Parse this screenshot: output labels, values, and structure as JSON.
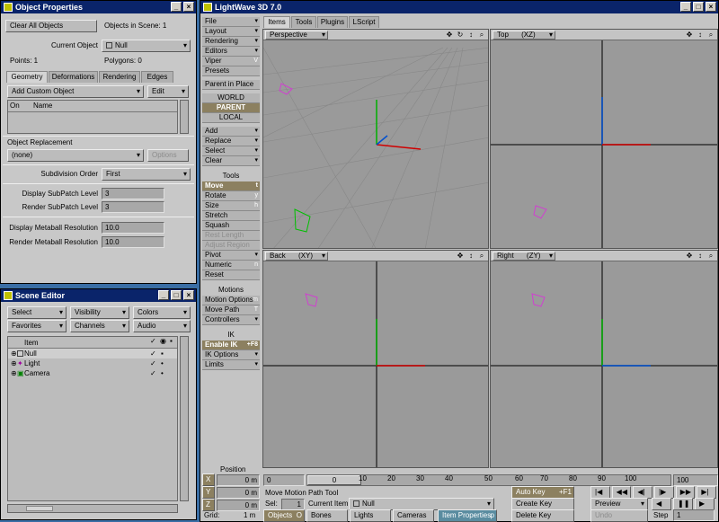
{
  "object_properties": {
    "title": "Object Properties",
    "clear_all": "Clear All Objects",
    "objects_in_scene": "Objects in Scene: 1",
    "current_object_label": "Current Object",
    "current_object_value": "Null",
    "points": "Points: 1",
    "polygons": "Polygons: 0",
    "tabs": [
      "Geometry",
      "Deformations",
      "Rendering",
      "Edges"
    ],
    "add_custom_object": "Add Custom Object",
    "edit": "Edit",
    "col_on": "On",
    "col_name": "Name",
    "object_replacement": "Object Replacement",
    "replacement_value": "(none)",
    "options": "Options",
    "subdivision_order_label": "Subdivision Order",
    "subdivision_order_value": "First",
    "display_subpatch_label": "Display SubPatch Level",
    "display_subpatch_value": "3",
    "render_subpatch_label": "Render SubPatch Level",
    "render_subpatch_value": "3",
    "display_metaball_label": "Display Metaball Resolution",
    "display_metaball_value": "10.0",
    "render_metaball_label": "Render Metaball Resolution",
    "render_metaball_value": "10.0"
  },
  "scene_editor": {
    "title": "Scene Editor",
    "select": "Select",
    "visibility": "Visibility",
    "colors": "Colors",
    "favorites": "Favorites",
    "channels": "Channels",
    "audio": "Audio",
    "col_item": "Item",
    "items": [
      "Null",
      "Light",
      "Camera"
    ]
  },
  "lightwave": {
    "title": "LightWave 3D 7.0",
    "top_tabs": [
      "Items",
      "Tools",
      "Plugins",
      "LScript"
    ],
    "menu": {
      "file": "File",
      "layout": "Layout",
      "rendering": "Rendering",
      "editors": "Editors",
      "viper": "Viper",
      "viper_key": "V",
      "presets": "Presets",
      "parent_in_place": "Parent in Place",
      "world": "WORLD",
      "parent": "PARENT",
      "local": "LOCAL",
      "add": "Add",
      "replace": "Replace",
      "select": "Select",
      "clear": "Clear",
      "tools_header": "Tools",
      "move": "Move",
      "move_key": "t",
      "rotate": "Rotate",
      "rotate_key": "y",
      "size": "Size",
      "size_key": "h",
      "stretch": "Stretch",
      "squash": "Squash",
      "rest_length": "Rest Length",
      "adjust_region": "Adjust Region",
      "pivot": "Pivot",
      "numeric": "Numeric",
      "numeric_key": "n",
      "reset": "Reset",
      "motions_header": "Motions",
      "motion_options": "Motion Options",
      "motion_options_key": "m",
      "move_path": "Move Path",
      "move_path_key": "T",
      "controllers": "Controllers",
      "ik_header": "IK",
      "enable_ik": "Enable IK",
      "enable_ik_key": "+F8",
      "ik_options": "IK Options",
      "limits": "Limits"
    },
    "viewports": {
      "perspective": "Perspective",
      "top": "Top",
      "top_axes": "(XZ)",
      "back": "Back",
      "back_axes": "(XY)",
      "right": "Right",
      "right_axes": "(ZY)"
    },
    "bottom": {
      "position": "Position",
      "x": "X",
      "y": "Y",
      "z": "Z",
      "x_val": "0 m",
      "y_val": "0 m",
      "z_val": "0 m",
      "grid_label": "Grid:",
      "grid_val": "1 m",
      "timeline_start": "0",
      "timeline_current": "0",
      "timeline_end": "100",
      "ticks": [
        "10",
        "20",
        "30",
        "40",
        "50",
        "60",
        "70",
        "80",
        "90",
        "100"
      ],
      "status": "Move Motion Path Tool",
      "sel_label": "Sel:",
      "sel_val": "1",
      "current_item_label": "Current Item",
      "current_item_val": "Null",
      "objects": "Objects",
      "objects_key": "O",
      "bones": "Bones",
      "lights": "Lights",
      "cameras": "Cameras",
      "item_properties": "Item Properties",
      "item_properties_key": "p",
      "auto_key": "Auto Key",
      "auto_key_key": "+F1",
      "create_key": "Create Key",
      "delete_key": "Delete Key",
      "preview": "Preview",
      "undo": "Undo",
      "step_label": "Step",
      "step_val": "1"
    }
  }
}
